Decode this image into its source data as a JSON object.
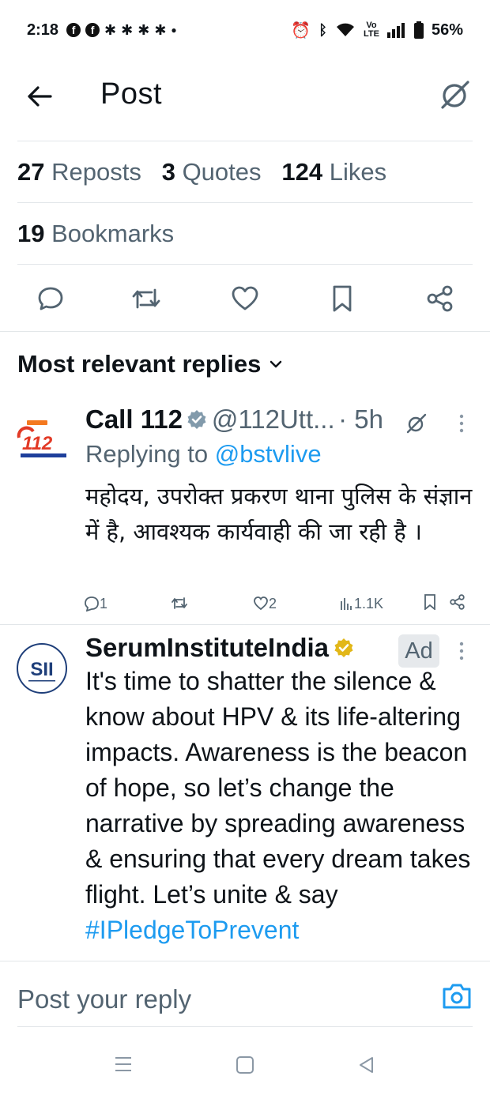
{
  "status": {
    "time": "2:18",
    "battery": "56%"
  },
  "header": {
    "title": "Post"
  },
  "stats": {
    "reposts_count": "27",
    "reposts_label": "Reposts",
    "quotes_count": "3",
    "quotes_label": "Quotes",
    "likes_count": "124",
    "likes_label": "Likes",
    "bookmarks_count": "19",
    "bookmarks_label": "Bookmarks"
  },
  "section": {
    "title": "Most relevant replies"
  },
  "replies": [
    {
      "name": "Call 112",
      "handle": "@112Utt...",
      "time": "· 5h",
      "replying_prefix": "Replying to",
      "replying_to": "@bstvlive",
      "text": "महोदय, उपरोक्त प्रकरण थाना पुलिस के संज्ञान में है, आवश्यक कार्यवाही की जा रही है ।",
      "replies": "1",
      "likes": "2",
      "views": "1.1K",
      "avatar_text": "112"
    },
    {
      "name": "SerumInstituteIndia",
      "ad_label": "Ad",
      "text": "It's time to shatter the silence & know about HPV & its life-altering impacts. Awareness is the beacon of hope, so let’s change the narrative by spreading awareness & ensuring that every dream takes flight. Let’s",
      "text_cut": "unite & say ",
      "hashtag": "#IPledgeToPrevent",
      "avatar_text": "SII"
    }
  ],
  "reply_bar": {
    "placeholder": "Post your reply"
  },
  "colors": {
    "accent": "#1d9bf0",
    "text": "#0f1419",
    "muted": "#536471",
    "divider": "#e2e6e9",
    "verified": "#e2b719"
  }
}
